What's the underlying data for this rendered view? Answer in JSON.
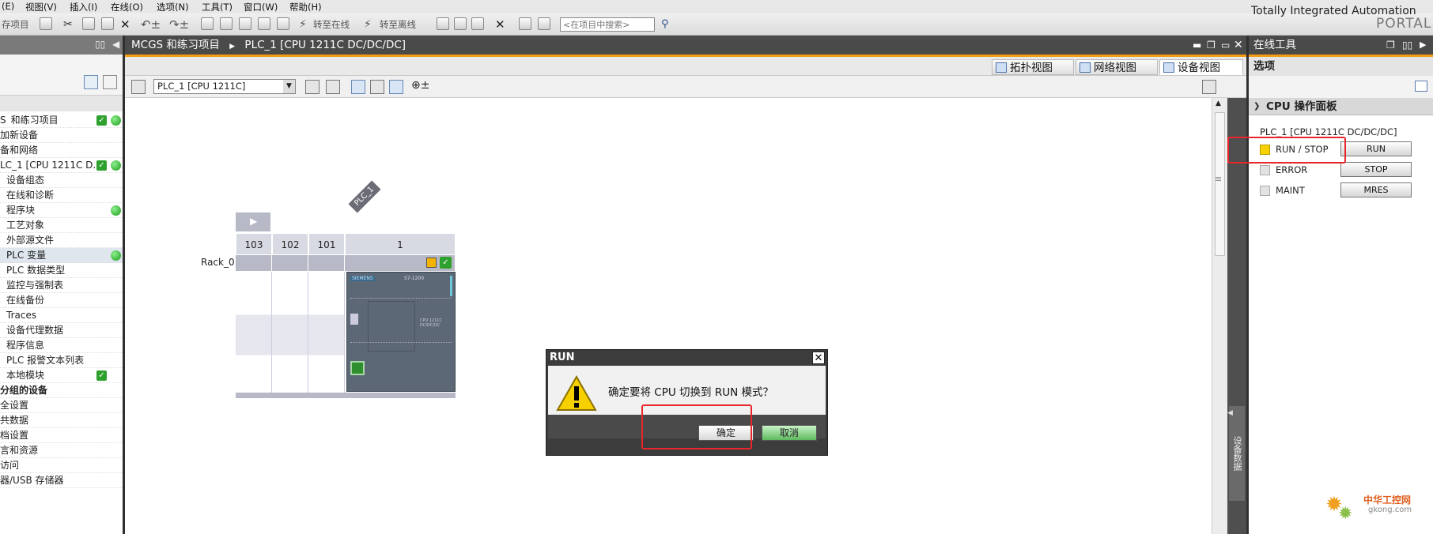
{
  "menu": [
    "(E)",
    "视图(V)",
    "插入(I)",
    "在线(O)",
    "选项(N)",
    "工具(T)",
    "窗口(W)",
    "帮助(H)"
  ],
  "toolbar": {
    "save_label": "存项目",
    "go_online": "转至在线",
    "go_offline": "转至离线",
    "search_placeholder": "<在项目中搜索>"
  },
  "brand": {
    "line1": "Totally Integrated Automation",
    "line2": "PORTAL"
  },
  "project_tree": [
    {
      "label": "和练习项目",
      "prefix": "S",
      "check": true,
      "dot": true
    },
    {
      "label": "加新设备"
    },
    {
      "label": "备和网络"
    },
    {
      "label": "LC_1 [CPU 1211C D...",
      "check": true,
      "dot": true
    },
    {
      "label": "设备组态"
    },
    {
      "label": "在线和诊断"
    },
    {
      "label": "程序块",
      "dot": true
    },
    {
      "label": "工艺对象"
    },
    {
      "label": "外部源文件"
    },
    {
      "label": "PLC 变量",
      "dot": true,
      "selected": true
    },
    {
      "label": "PLC 数据类型"
    },
    {
      "label": "监控与强制表"
    },
    {
      "label": "在线备份"
    },
    {
      "label": "Traces"
    },
    {
      "label": "设备代理数据"
    },
    {
      "label": "程序信息"
    },
    {
      "label": "PLC 报警文本列表"
    },
    {
      "label": "本地模块",
      "check": true
    },
    {
      "label": "分组的设备",
      "bold": true
    },
    {
      "label": "全设置"
    },
    {
      "label": "共数据"
    },
    {
      "label": "档设置"
    },
    {
      "label": "言和资源"
    },
    {
      "label": "访问"
    },
    {
      "label": "器/USB 存储器"
    }
  ],
  "main": {
    "breadcrumb_project": "MCGS 和练习项目",
    "breadcrumb_device": "PLC_1 [CPU 1211C DC/DC/DC]",
    "tabs": [
      "拓扑视图",
      "网络视图",
      "设备视图"
    ],
    "device_select": "PLC_1 [CPU 1211C]",
    "plc_tag": "PLC_1",
    "rack_label": "Rack_0",
    "slots": [
      "103",
      "102",
      "101",
      "1"
    ],
    "module_brand": "SIEMENS",
    "module_model": "S7-1200",
    "module_cpu_label": "CPU 1211C DC/DC/DC",
    "side_tab": "设备数据"
  },
  "right": {
    "title": "在线工具",
    "options": "选项",
    "section": "CPU 操作面板",
    "cpu_name": "PLC_1 [CPU 1211C DC/DC/DC]",
    "rows": [
      {
        "label": "RUN / STOP",
        "button": "RUN",
        "led_color": "#f6d200"
      },
      {
        "label": "ERROR",
        "button": "STOP",
        "led_color": "#e2e2e2"
      },
      {
        "label": "MAINT",
        "button": "MRES",
        "led_color": "#e2e2e2"
      }
    ]
  },
  "dialog": {
    "title": "RUN",
    "message": "确定要将 CPU 切换到 RUN 模式？",
    "ok": "确定",
    "cancel": "取消"
  },
  "watermark": {
    "line1": "中华工控网",
    "line2": "gkong.com"
  }
}
